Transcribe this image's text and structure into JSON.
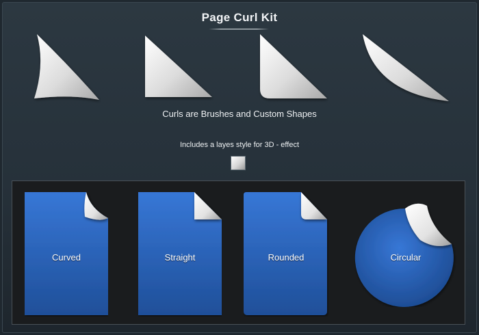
{
  "header": {
    "title": "Page Curl Kit"
  },
  "captions": {
    "main": "Curls are Brushes and Custom Shapes",
    "sub": "Includes a layes style for 3D - effect"
  },
  "curl_shapes": [
    "curved",
    "straight",
    "rounded",
    "circular"
  ],
  "demo_cards": [
    {
      "label": "Curved"
    },
    {
      "label": "Straight"
    },
    {
      "label": "Rounded"
    },
    {
      "label": "Circular"
    }
  ],
  "colors": {
    "background": "#26313a",
    "panel": "#1a1c1e",
    "card_blue_top": "#3777d6",
    "card_blue_bottom": "#1f4f99",
    "curl_light": "#ffffff",
    "curl_dark": "#b5b5b5"
  }
}
